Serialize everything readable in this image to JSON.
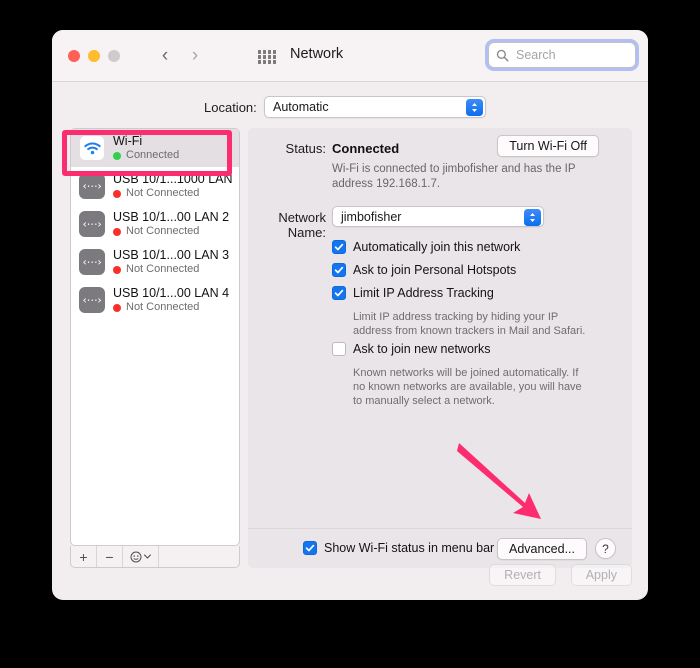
{
  "window": {
    "title": "Network",
    "traffic_lights": [
      "close",
      "minimize",
      "zoom"
    ]
  },
  "toolbar": {
    "back_icon": "chevron-left-icon",
    "forward_icon": "chevron-right-icon",
    "grid_icon": "grid-icon",
    "search": {
      "placeholder": "Search",
      "value": "",
      "icon": "search-icon"
    }
  },
  "location": {
    "label": "Location:",
    "value": "Automatic",
    "options": [
      "Automatic"
    ]
  },
  "sidebar": {
    "services": [
      {
        "name": "Wi-Fi",
        "status": "Connected",
        "status_color": "#2fd24a",
        "icon": "wifi-icon",
        "selected": true
      },
      {
        "name": "USB 10/1...1000 LAN",
        "status": "Not Connected",
        "status_color": "#fb2f29",
        "icon": "ethernet-icon",
        "selected": false
      },
      {
        "name": "USB 10/1...00 LAN 2",
        "status": "Not Connected",
        "status_color": "#fb2f29",
        "icon": "ethernet-icon",
        "selected": false
      },
      {
        "name": "USB 10/1...00 LAN 3",
        "status": "Not Connected",
        "status_color": "#fb2f29",
        "icon": "ethernet-icon",
        "selected": false
      },
      {
        "name": "USB 10/1...00 LAN 4",
        "status": "Not Connected",
        "status_color": "#fb2f29",
        "icon": "ethernet-icon",
        "selected": false
      }
    ],
    "toolbar": {
      "add_label": "+",
      "remove_label": "−",
      "action_icon": "gear-icon",
      "action_chevron": "chevron-down-icon"
    }
  },
  "main": {
    "status_label": "Status:",
    "status_value": "Connected",
    "turn_off_button": "Turn Wi-Fi Off",
    "status_description": "Wi-Fi is connected to jimbofisher and has the IP address 192.168.1.7.",
    "network_name_label": "Network Name:",
    "network_name_value": "jimbofisher",
    "checkboxes": [
      {
        "label": "Automatically join this network",
        "checked": true
      },
      {
        "label": "Ask to join Personal Hotspots",
        "checked": true
      },
      {
        "label": "Limit IP Address Tracking",
        "checked": true
      },
      {
        "label": "Ask to join new networks",
        "checked": false
      }
    ],
    "limit_ip_help": "Limit IP address tracking by hiding your IP address from known trackers in Mail and Safari.",
    "new_networks_help": "Known networks will be joined automatically. If no known networks are available, you will have to manually select a network.",
    "show_status_checkbox": {
      "label": "Show Wi-Fi status in menu bar",
      "checked": true
    },
    "advanced_button": "Advanced...",
    "help_button": "?"
  },
  "footer": {
    "revert_button": "Revert",
    "apply_button": "Apply",
    "buttons_disabled": true
  },
  "annotations": {
    "highlight_color": "#fb2d6e",
    "highlight_target": "Wi-Fi",
    "arrow_color": "#fb2d6e",
    "arrow_target": "Advanced..."
  }
}
